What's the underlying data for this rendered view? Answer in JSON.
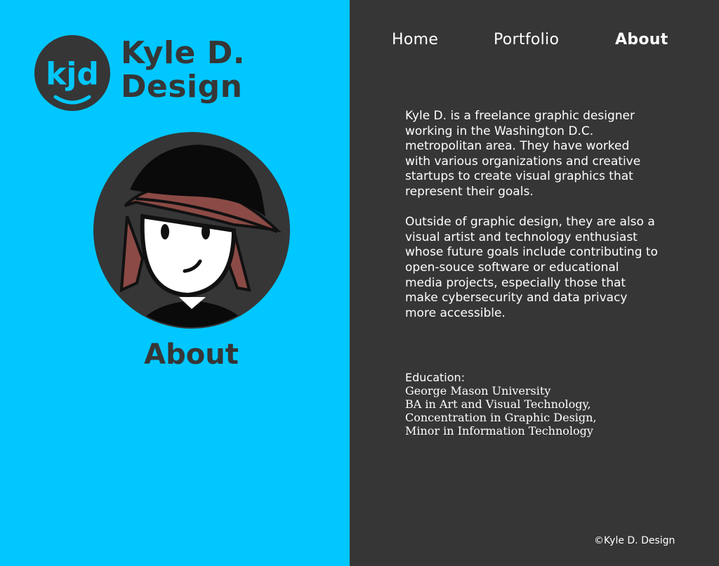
{
  "brand": {
    "logo_text": "kjd",
    "name_line1": "Kyle D.",
    "name_line2": "Design"
  },
  "left": {
    "heading": "About"
  },
  "nav": {
    "items": [
      {
        "label": "Home"
      },
      {
        "label": "Portfolio"
      },
      {
        "label": "About",
        "active": true
      }
    ]
  },
  "bio": {
    "paragraph1": "Kyle D. is a freelance graphic designer working in the Washington D.C. metropolitan area. They have worked with various organizations and creative startups to create visual graphics that represent their goals.",
    "paragraph2": "Outside of graphic design, they are also a visual artist and technology enthusiast whose future goals include contributing to open-souce software  or educational media projects, especially those that make cybersecurity and data privacy more accessible."
  },
  "education": {
    "label": "Education:",
    "school": "George Mason University",
    "degree": "BA in Art and Visual Technology,",
    "concentration": "Concentration in Graphic Design,",
    "minor": "Minor in Information Technology"
  },
  "footer": {
    "copyright": "©Kyle D. Design"
  },
  "colors": {
    "accent": "#00c7ff",
    "dark": "#363636",
    "hair": "#8b4a45",
    "text": "#ffffff"
  },
  "icons": {
    "logo": "kjd-smile-logo-icon",
    "avatar": "avatar-illustration"
  }
}
